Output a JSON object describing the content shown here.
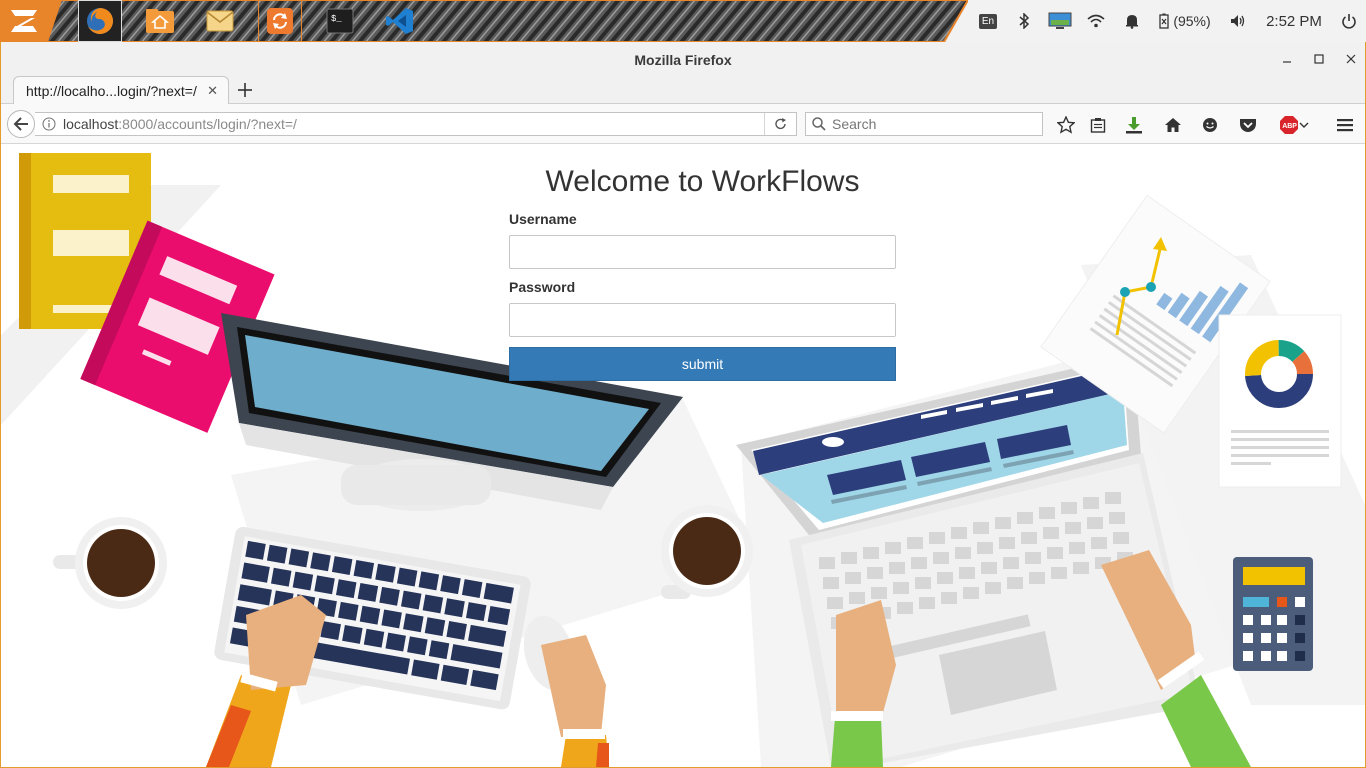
{
  "taskbar": {
    "apps": [
      {
        "name": "zorin-menu-icon"
      },
      {
        "name": "firefox-icon"
      },
      {
        "name": "files-icon"
      },
      {
        "name": "mail-icon"
      },
      {
        "name": "update-icon"
      },
      {
        "name": "terminal-icon"
      },
      {
        "name": "vscode-icon"
      }
    ],
    "tray": {
      "keyboard_layout": "En",
      "battery": "(95%)",
      "clock": "2:52 PM"
    },
    "colors": {
      "accent": "#e8842a"
    }
  },
  "window": {
    "title": "Mozilla Firefox"
  },
  "tab": {
    "title": "http://localho...login/?next=/"
  },
  "url": {
    "host": "localhost",
    "rest": ":8000/accounts/login/?next=/"
  },
  "search": {
    "placeholder": "Search"
  },
  "login": {
    "heading": "Welcome to WorkFlows",
    "username_label": "Username",
    "username_value": "",
    "password_label": "Password",
    "password_value": "",
    "submit_label": "submit"
  },
  "colors": {
    "primary_button": "#337ab7",
    "window_border": "#e39b2e"
  }
}
